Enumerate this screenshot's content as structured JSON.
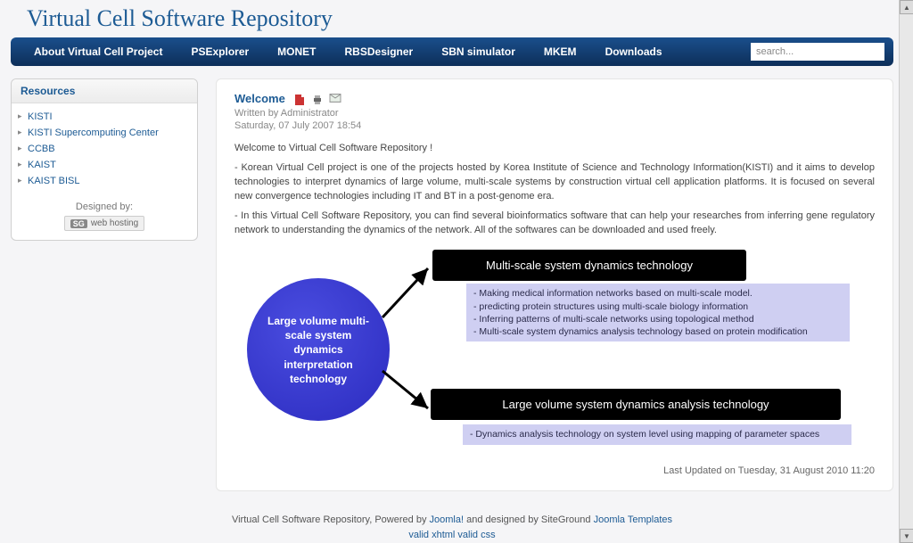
{
  "site_title": "Virtual Cell Software Repository",
  "nav": {
    "items": [
      "About Virtual Cell Project",
      "PSExplorer",
      "MONET",
      "RBSDesigner",
      "SBN simulator",
      "MKEM",
      "Downloads"
    ],
    "search_placeholder": "search..."
  },
  "sidebar": {
    "header": "Resources",
    "items": [
      "KISTI",
      "KISTI Supercomputing Center",
      "CCBB",
      "KAIST",
      "KAIST BISL"
    ],
    "designed_label": "Designed by:",
    "host_badge": "SG",
    "host_label": "web hosting"
  },
  "article": {
    "title": "Welcome",
    "author_line": "Written by Administrator",
    "date_line": "Saturday, 07 July 2007 18:54",
    "p1": "Welcome to Virtual Cell Software Repository !",
    "p2": "- Korean Virtual Cell project is one of the projects hosted by Korea Institute of Science and Technology Information(KISTI) and it aims to develop technologies to interpret dynamics of large volume, multi-scale systems by construction virtual cell application platforms. It is focused on several new convergence technologies including IT and BT in a post-genome era.",
    "p3": "- In this Virtual Cell Software Repository, you can find several bioinformatics software that can help your researches from inferring gene regulatory network to understanding the dynamics of the network. All of the softwares can be downloaded and used freely.",
    "updated": "Last Updated on Tuesday, 31 August 2010 11:20"
  },
  "diagram": {
    "circle": "Large volume multi-scale system dynamics interpretation technology",
    "box_top": "Multi-scale system dynamics technology",
    "box_bottom": "Large volume system dynamics analysis technology",
    "info_top_1": "- Making medical information networks based on multi-scale model.",
    "info_top_2": "- predicting protein structures using multi-scale biology information",
    "info_top_3": "- Inferring patterns of multi-scale networks using topological method",
    "info_top_4": "- Multi-scale system dynamics analysis technology based on protein modification",
    "info_bottom": "- Dynamics analysis technology on system level using mapping of parameter spaces"
  },
  "footer": {
    "prefix": "Virtual Cell Software Repository, Powered by ",
    "link1": "Joomla!",
    "mid": " and designed by SiteGround ",
    "link2": "Joomla Templates",
    "valid1": "valid xhtml",
    "valid2": "valid css"
  }
}
